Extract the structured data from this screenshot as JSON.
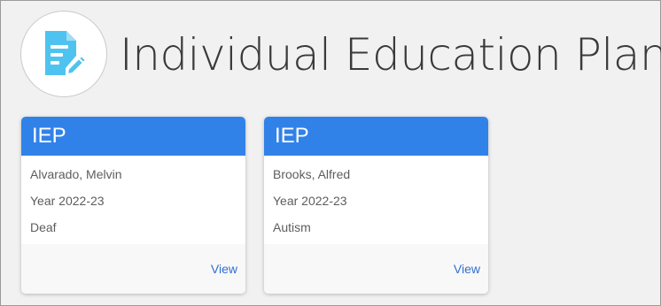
{
  "header": {
    "title": "Individual Education Plan",
    "logo_icon": "document-edit-icon",
    "accent_color": "#4fc3f0"
  },
  "cards": [
    {
      "title": "IEP",
      "student": "Alvarado, Melvin",
      "year": "Year 2022-23",
      "category": "Deaf",
      "action": "View"
    },
    {
      "title": "IEP",
      "student": "Brooks, Alfred",
      "year": "Year 2022-23",
      "category": "Autism",
      "action": "View"
    }
  ],
  "colors": {
    "card_header": "#3182e8",
    "link": "#2f6fd1"
  }
}
